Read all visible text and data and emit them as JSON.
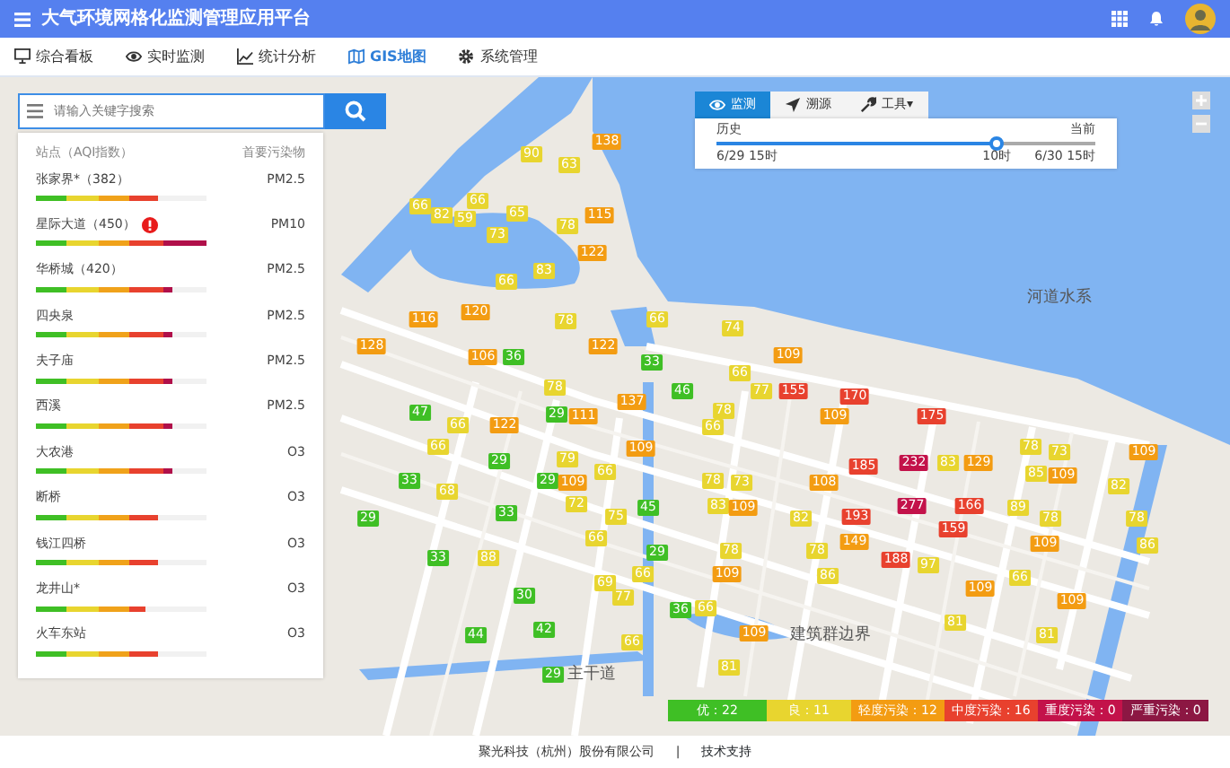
{
  "header": {
    "title": "大气环境网格化监测管理应用平台"
  },
  "nav": [
    {
      "label": "综合看板",
      "selected": false
    },
    {
      "label": "实时监测",
      "selected": false
    },
    {
      "label": "统计分析",
      "selected": false
    },
    {
      "label": "GIS地图",
      "selected": true
    },
    {
      "label": "系统管理",
      "selected": false
    }
  ],
  "search": {
    "placeholder": "请输入关键字搜索"
  },
  "station_list": {
    "columns": [
      "站点（AQI指数）",
      "首要污染物"
    ],
    "rows": [
      {
        "name": "张家界*（382）",
        "pollutant": "PM2.5",
        "level": 0.72,
        "alert": false
      },
      {
        "name": "星际大道（450）",
        "pollutant": "PM10",
        "level": 1.0,
        "alert": true
      },
      {
        "name": "华桥城（420）",
        "pollutant": "PM2.5",
        "level": 0.8,
        "alert": false
      },
      {
        "name": "四央泉",
        "pollutant": "PM2.5",
        "level": 0.8,
        "alert": false
      },
      {
        "name": "夫子庙",
        "pollutant": "PM2.5",
        "level": 0.8,
        "alert": false
      },
      {
        "name": "西溪",
        "pollutant": "PM2.5",
        "level": 0.8,
        "alert": false
      },
      {
        "name": "大农港",
        "pollutant": "O3",
        "level": 0.8,
        "alert": false
      },
      {
        "name": "断桥",
        "pollutant": "O3",
        "level": 0.72,
        "alert": false
      },
      {
        "name": "钱江四桥",
        "pollutant": "O3",
        "level": 0.72,
        "alert": false
      },
      {
        "name": "龙井山*",
        "pollutant": "O3",
        "level": 0.64,
        "alert": false
      },
      {
        "name": "火车东站",
        "pollutant": "O3",
        "level": 0.72,
        "alert": false
      }
    ]
  },
  "map_tabs": [
    {
      "label": "监测",
      "selected": true
    },
    {
      "label": "溯源",
      "selected": false
    },
    {
      "label": "工具▾",
      "selected": false
    }
  ],
  "timeline": {
    "start_label": "历史",
    "end_label": "当前",
    "start_time": "6/29 15时",
    "current_time": "10时",
    "end_time": "6/30 15时",
    "level": 0.74
  },
  "map_labels": [
    "河道水系",
    "建筑群边界",
    "主干道"
  ],
  "markers": [
    {
      "value": "90",
      "kind": "moderate"
    },
    {
      "value": "138",
      "kind": "light"
    },
    {
      "value": "63",
      "kind": "moderate"
    },
    {
      "value": "66",
      "kind": "moderate"
    },
    {
      "value": "66",
      "kind": "moderate"
    },
    {
      "value": "82",
      "kind": "moderate"
    },
    {
      "value": "59",
      "kind": "moderate"
    },
    {
      "value": "65",
      "kind": "moderate"
    },
    {
      "value": "78",
      "kind": "moderate"
    },
    {
      "value": "115",
      "kind": "light"
    },
    {
      "value": "73",
      "kind": "moderate"
    },
    {
      "value": "122",
      "kind": "light"
    },
    {
      "value": "83",
      "kind": "moderate"
    },
    {
      "value": "66",
      "kind": "moderate"
    },
    {
      "value": "120",
      "kind": "light"
    },
    {
      "value": "116",
      "kind": "light"
    },
    {
      "value": "78",
      "kind": "moderate"
    },
    {
      "value": "122",
      "kind": "light"
    },
    {
      "value": "66",
      "kind": "moderate"
    },
    {
      "value": "74",
      "kind": "moderate"
    },
    {
      "value": "128",
      "kind": "light"
    },
    {
      "value": "106",
      "kind": "light"
    },
    {
      "value": "36",
      "kind": "good"
    },
    {
      "value": "33",
      "kind": "good"
    },
    {
      "value": "109",
      "kind": "light"
    },
    {
      "value": "66",
      "kind": "moderate"
    },
    {
      "value": "46",
      "kind": "good"
    },
    {
      "value": "77",
      "kind": "moderate"
    },
    {
      "value": "155",
      "kind": "medium"
    },
    {
      "value": "170",
      "kind": "medium"
    },
    {
      "value": "109",
      "kind": "light"
    },
    {
      "value": "175",
      "kind": "medium"
    },
    {
      "value": "78",
      "kind": "moderate"
    },
    {
      "value": "137",
      "kind": "light"
    },
    {
      "value": "47",
      "kind": "good"
    },
    {
      "value": "66",
      "kind": "moderate"
    },
    {
      "value": "122",
      "kind": "light"
    },
    {
      "value": "29",
      "kind": "good"
    },
    {
      "value": "111",
      "kind": "light"
    },
    {
      "value": "78",
      "kind": "moderate"
    },
    {
      "value": "66",
      "kind": "moderate"
    },
    {
      "value": "66",
      "kind": "moderate"
    },
    {
      "value": "109",
      "kind": "light"
    },
    {
      "value": "29",
      "kind": "good"
    },
    {
      "value": "79",
      "kind": "moderate"
    },
    {
      "value": "66",
      "kind": "moderate"
    },
    {
      "value": "33",
      "kind": "good"
    },
    {
      "value": "29",
      "kind": "good"
    },
    {
      "value": "109",
      "kind": "light"
    },
    {
      "value": "78",
      "kind": "moderate"
    },
    {
      "value": "73",
      "kind": "moderate"
    },
    {
      "value": "108",
      "kind": "light"
    },
    {
      "value": "185",
      "kind": "medium"
    },
    {
      "value": "232",
      "kind": "heavy"
    },
    {
      "value": "83",
      "kind": "moderate"
    },
    {
      "value": "129",
      "kind": "light"
    },
    {
      "value": "78",
      "kind": "moderate"
    },
    {
      "value": "73",
      "kind": "moderate"
    },
    {
      "value": "109",
      "kind": "light"
    },
    {
      "value": "85",
      "kind": "moderate"
    },
    {
      "value": "109",
      "kind": "light"
    },
    {
      "value": "82",
      "kind": "moderate"
    },
    {
      "value": "68",
      "kind": "moderate"
    },
    {
      "value": "29",
      "kind": "good"
    },
    {
      "value": "72",
      "kind": "moderate"
    },
    {
      "value": "33",
      "kind": "good"
    },
    {
      "value": "75",
      "kind": "moderate"
    },
    {
      "value": "45",
      "kind": "good"
    },
    {
      "value": "83",
      "kind": "moderate"
    },
    {
      "value": "109",
      "kind": "light"
    },
    {
      "value": "82",
      "kind": "moderate"
    },
    {
      "value": "193",
      "kind": "medium"
    },
    {
      "value": "277",
      "kind": "heavy"
    },
    {
      "value": "166",
      "kind": "medium"
    },
    {
      "value": "89",
      "kind": "moderate"
    },
    {
      "value": "78",
      "kind": "moderate"
    },
    {
      "value": "78",
      "kind": "moderate"
    },
    {
      "value": "159",
      "kind": "medium"
    },
    {
      "value": "149",
      "kind": "light"
    },
    {
      "value": "109",
      "kind": "light"
    },
    {
      "value": "86",
      "kind": "moderate"
    },
    {
      "value": "66",
      "kind": "moderate"
    },
    {
      "value": "29",
      "kind": "good"
    },
    {
      "value": "78",
      "kind": "moderate"
    },
    {
      "value": "78",
      "kind": "moderate"
    },
    {
      "value": "188",
      "kind": "medium"
    },
    {
      "value": "97",
      "kind": "moderate"
    },
    {
      "value": "33",
      "kind": "good"
    },
    {
      "value": "88",
      "kind": "moderate"
    },
    {
      "value": "66",
      "kind": "moderate"
    },
    {
      "value": "109",
      "kind": "light"
    },
    {
      "value": "86",
      "kind": "moderate"
    },
    {
      "value": "66",
      "kind": "moderate"
    },
    {
      "value": "109",
      "kind": "light"
    },
    {
      "value": "69",
      "kind": "moderate"
    },
    {
      "value": "30",
      "kind": "good"
    },
    {
      "value": "77",
      "kind": "moderate"
    },
    {
      "value": "109",
      "kind": "light"
    },
    {
      "value": "36",
      "kind": "good"
    },
    {
      "value": "66",
      "kind": "moderate"
    },
    {
      "value": "44",
      "kind": "good"
    },
    {
      "value": "42",
      "kind": "good"
    },
    {
      "value": "66",
      "kind": "moderate"
    },
    {
      "value": "109",
      "kind": "light"
    },
    {
      "value": "81",
      "kind": "moderate"
    },
    {
      "value": "81",
      "kind": "moderate"
    },
    {
      "value": "29",
      "kind": "good"
    },
    {
      "value": "81",
      "kind": "moderate"
    }
  ],
  "legend": [
    {
      "label": "优：22",
      "kind": "good"
    },
    {
      "label": "良：11",
      "kind": "moderate"
    },
    {
      "label": "轻度污染：12",
      "kind": "light"
    },
    {
      "label": "中度污染：16",
      "kind": "medium"
    },
    {
      "label": "重度污染：0",
      "kind": "heavy"
    },
    {
      "label": "严重污染：0",
      "kind": "severe"
    }
  ],
  "footer": {
    "company": "聚光科技（杭州）股份有限公司",
    "separator": "|",
    "link": "技术支持"
  }
}
